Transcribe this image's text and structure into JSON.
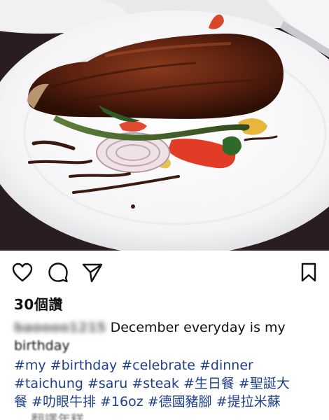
{
  "post": {
    "image_alt": "Steak dinner on a white plate",
    "likes_label": "30個讚",
    "caption": {
      "username": "baoooo1215",
      "text": "December everyday is my",
      "text_line2": "birthday"
    },
    "hashtags_line1": "#my #birthday #celebrate #dinner",
    "hashtags_line2": "#taichung #saru #steak #生日餐 #聖誕大",
    "hashtags_line3": "餐 #叻眼牛排 #16oz #德國豬腳 #提拉米蘇",
    "footer_partial": "... 翻譯年糕"
  },
  "icons": {
    "like": "heart-icon",
    "comment": "comment-bubble-icon",
    "share": "paper-plane-icon",
    "save": "bookmark-icon"
  },
  "colors": {
    "hashtag": "#1e3f8c",
    "text": "#111111",
    "background": "#ffffff"
  }
}
